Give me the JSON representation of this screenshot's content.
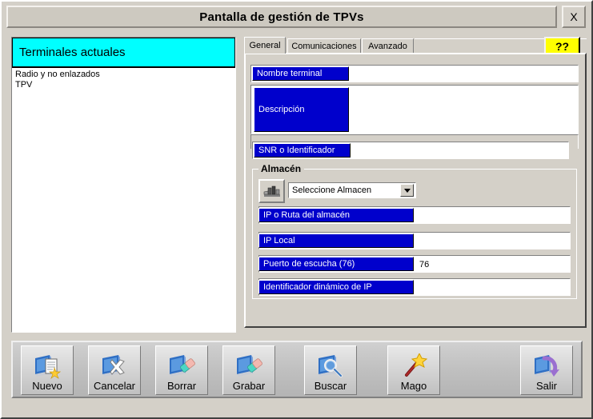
{
  "window": {
    "title": "Pantalla de gestión de TPVs",
    "close_label": "X"
  },
  "left_panel": {
    "header": "Terminales actuales",
    "items": [
      {
        "label": "Radio y no enlazados"
      },
      {
        "label": "TPV"
      }
    ]
  },
  "tabs": [
    {
      "label": "General",
      "active": true
    },
    {
      "label": "Comunicaciones",
      "active": false
    },
    {
      "label": "Avanzado",
      "active": false
    }
  ],
  "help_button": {
    "label": "??"
  },
  "general_tab": {
    "fields": [
      {
        "label": "Nombre terminal",
        "value": ""
      },
      {
        "label": "Descripción",
        "value": ""
      },
      {
        "label": "SNR o Identificador",
        "value": ""
      }
    ],
    "almacen_group": {
      "legend": "Almacén",
      "warehouse_icon": "warehouse-icon",
      "combo": {
        "selected": "Seleccione Almacen",
        "options": [
          "Seleccione Almacen"
        ]
      },
      "fields": [
        {
          "label": "IP o Ruta del almacén",
          "value": ""
        },
        {
          "label": "IP Local",
          "value": ""
        },
        {
          "label": "Puerto de escucha (76)",
          "value": "76"
        },
        {
          "label": "Identificador dinámico de IP",
          "value": ""
        }
      ]
    }
  },
  "toolbar": {
    "buttons": [
      {
        "label": "Nuevo",
        "icon": "new-document-icon"
      },
      {
        "label": "Cancelar",
        "icon": "cancel-x-icon"
      },
      {
        "label": "Borrar",
        "icon": "eraser-icon"
      },
      {
        "label": "Grabar",
        "icon": "save-eraser-icon"
      },
      {
        "label": "Buscar",
        "icon": "magnifier-icon"
      },
      {
        "label": "Mago",
        "icon": "magic-wand-icon"
      },
      {
        "label": "Salir",
        "icon": "exit-arrow-icon"
      }
    ]
  },
  "colors": {
    "window_bg": "#d4d0c8",
    "label_blue": "#0000cc",
    "header_cyan": "#00ffff",
    "help_yellow": "#ffff00",
    "toolbar_gray": "#c0c0c0"
  }
}
